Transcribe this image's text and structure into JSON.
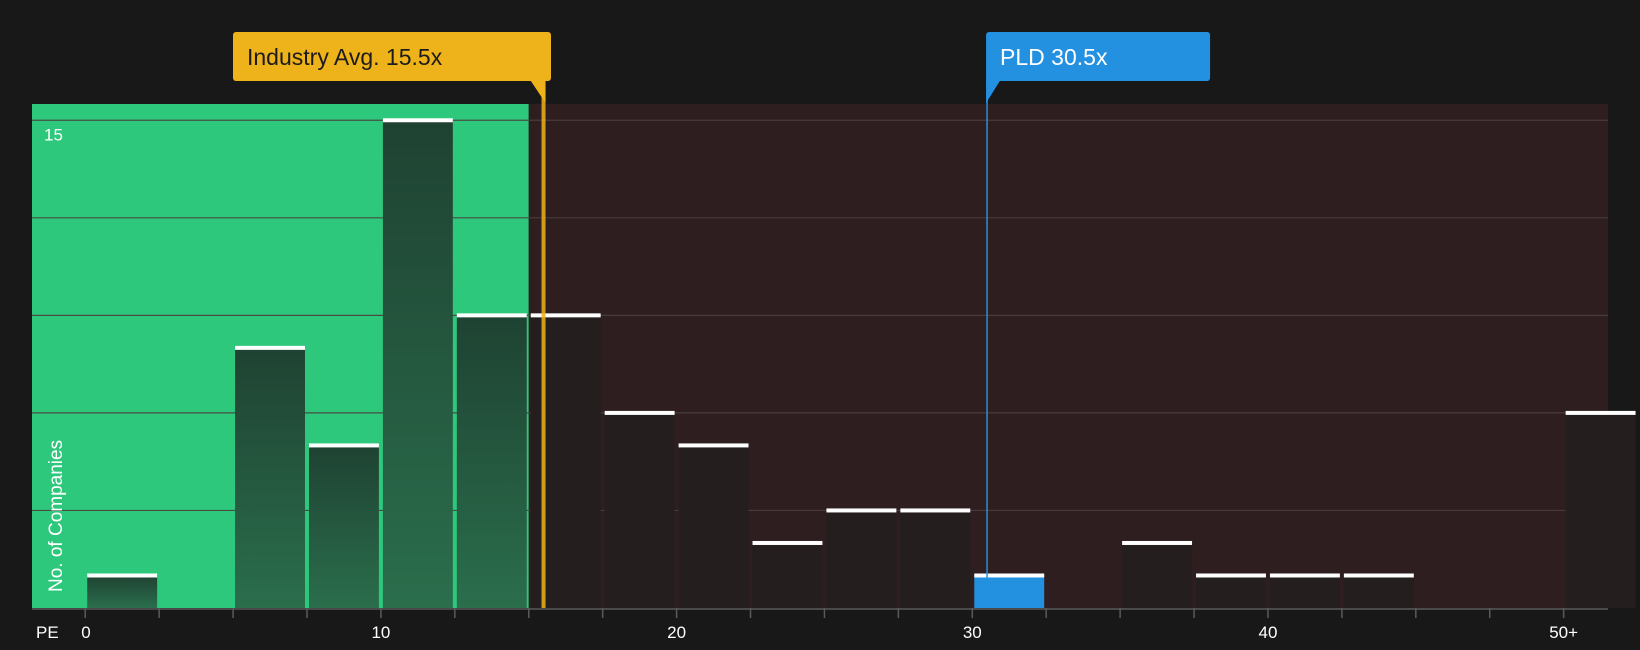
{
  "chart_data": {
    "type": "bar",
    "xlabel": "PE",
    "ylabel": "No. of Companies",
    "xlim": [
      -1.8,
      51.5
    ],
    "ylim": [
      0,
      15.5
    ],
    "x_ticks": [
      {
        "value": 0,
        "label": "0"
      },
      {
        "value": 10,
        "label": "10"
      },
      {
        "value": 20,
        "label": "20"
      },
      {
        "value": 30,
        "label": "30"
      },
      {
        "value": 40,
        "label": "40"
      },
      {
        "value": 50,
        "label": "50+"
      }
    ],
    "y_ticks": [
      {
        "value": 15,
        "label": "15"
      }
    ],
    "bin_width": 2.5,
    "bins": [
      {
        "start": 0,
        "count": 1
      },
      {
        "start": 5,
        "count": 8
      },
      {
        "start": 7.5,
        "count": 5
      },
      {
        "start": 10,
        "count": 15
      },
      {
        "start": 12.5,
        "count": 9
      },
      {
        "start": 15,
        "count": 9
      },
      {
        "start": 17.5,
        "count": 6
      },
      {
        "start": 20,
        "count": 5
      },
      {
        "start": 22.5,
        "count": 2
      },
      {
        "start": 25,
        "count": 3
      },
      {
        "start": 27.5,
        "count": 3
      },
      {
        "start": 30,
        "count": 1
      },
      {
        "start": 35,
        "count": 2
      },
      {
        "start": 37.5,
        "count": 1
      },
      {
        "start": 40,
        "count": 1
      },
      {
        "start": 42.5,
        "count": 1
      },
      {
        "start": 50,
        "count": 6
      }
    ],
    "highlight_bin_start": 30,
    "undervalued_upper": 15,
    "industry_avg": {
      "value": 15.5,
      "label": "Industry Avg. 15.5x"
    },
    "company": {
      "value": 30.5,
      "label": "PLD 30.5x"
    }
  },
  "colors": {
    "background": "#181818",
    "green_zone": "#2ec87c",
    "red_zone": "#2e1e1f",
    "bar_in_green": "#234b38",
    "bar_in_red": "#241e1e",
    "bar_highlight": "#2391e0",
    "bar_cap": "#ffffff",
    "industry_color": "#eeb21a",
    "company_color": "#2391e0",
    "grid": "#4a3f40"
  }
}
